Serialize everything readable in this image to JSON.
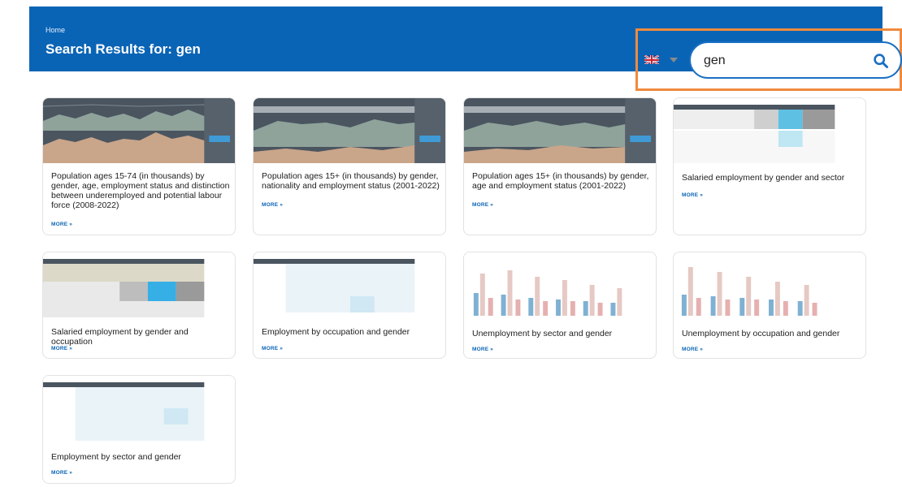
{
  "header": {
    "breadcrumb": "Home",
    "title": "Search Results for: gen"
  },
  "search": {
    "value": "gen",
    "language_icon": "uk-flag-icon"
  },
  "more_label": "MORE »",
  "cards": [
    {
      "title": "Population ages 15-74 (in thousands) by gender, age, employment status and distinction between underemployed and potential labour force (2008-2022)",
      "thumbnail": "dark-dashboard"
    },
    {
      "title": "Population ages 15+ (in thousands) by gender, nationality and employment status (2001-2022)",
      "thumbnail": "dark-dashboard"
    },
    {
      "title": "Population ages 15+ (in thousands) by gender, age and employment status (2001-2022)",
      "thumbnail": "dark-dashboard"
    },
    {
      "title": "Salaried employment by gender and sector",
      "thumbnail": "table"
    },
    {
      "title": "Salaried employment by gender and occupation",
      "thumbnail": "table-gray"
    },
    {
      "title": "Employment by occupation and gender",
      "thumbnail": "table"
    },
    {
      "title": "Unemployment by sector and gender",
      "thumbnail": "bar-chart"
    },
    {
      "title": "Unemployment by occupation and gender",
      "thumbnail": "bar-chart"
    },
    {
      "title": "Employment by sector and gender",
      "thumbnail": "table"
    }
  ]
}
